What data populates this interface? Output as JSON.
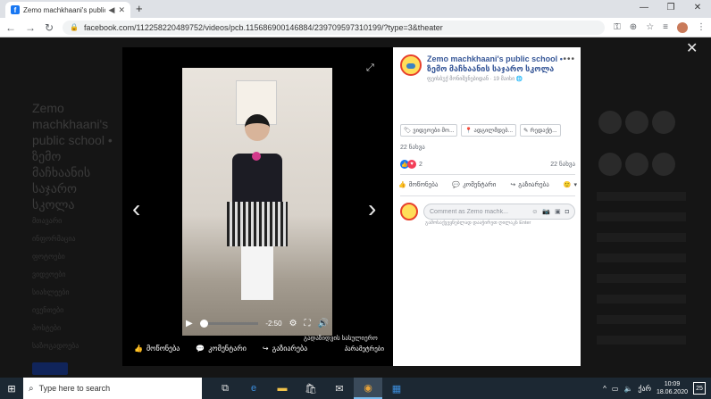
{
  "browser": {
    "tab_title": "Zemo machkhaani's public s",
    "url": "facebook.com/112258220489752/videos/pcb.115686900146884/239709597310199/?type=3&theater"
  },
  "video": {
    "time": "-2:50",
    "progress": 0.0,
    "tagged_label": "გადაზიდვის სასულიერო",
    "like_label": "მოწონება",
    "comment_label": "კომენტარი",
    "share_label": "გაზიარება",
    "options_label": "პარამეტრები"
  },
  "post": {
    "page_name": "Zemo machkhaani's public school",
    "page_name_ka": "ზემო მაჩხაანის საჯარო სკოლა",
    "subtitle": "ფეისბუქ მონიშვნებიდან · 19 მაისი",
    "tags": [
      "ვიდეოები მო...",
      "ადგილმდებ...",
      "რედაქტ..."
    ],
    "views_top": "22 ნახვა",
    "reaction_count": "2",
    "views_right": "22 ნახვა",
    "like": "მოწონება",
    "comment": "კომენტარი",
    "share": "გაზიარება",
    "comment_placeholder": "Comment as Zemo machk...",
    "enter_hint": "გამოსაქვეყნებლად დააჭირეთ ღილაკს Enter"
  },
  "background_page": {
    "title_lines": [
      "Zemo machkhaani's",
      "public school •",
      "ზემო მაჩხაანის",
      "საჯარო სკოლა"
    ],
    "menu_items": [
      "მთავარი",
      "ინფორმაცია",
      "ფოტოები",
      "ვიდეოები",
      "სიახლეები",
      "ივენთები",
      "პოსტები",
      "საზოგადოება"
    ]
  },
  "taskbar": {
    "search_placeholder": "Type here to search",
    "time": "10:09",
    "date": "18.06.2020",
    "notifications": "25"
  }
}
